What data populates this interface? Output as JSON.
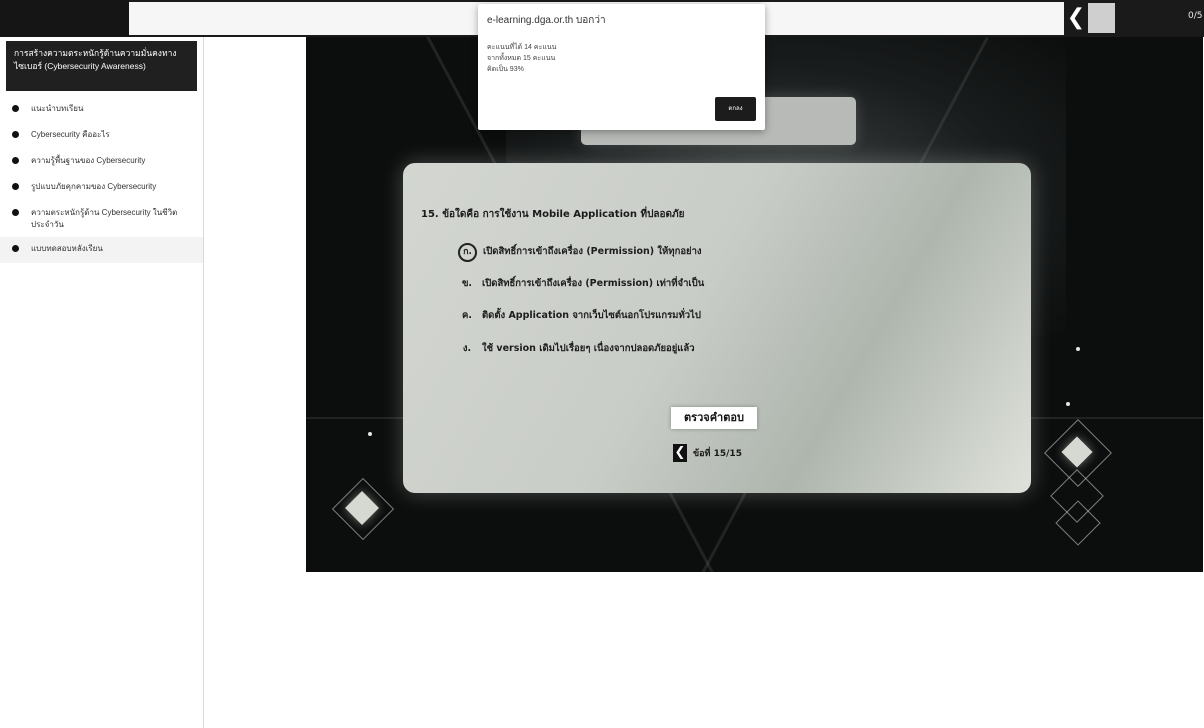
{
  "browser": {
    "back_glyph": "❮",
    "counter": "0/5"
  },
  "sidebar": {
    "title": "การสร้างความตระหนักรู้ด้านความมั่นคงทางไซเบอร์ (Cybersecurity Awareness)",
    "items": [
      {
        "label": "แนะนำบทเรียน"
      },
      {
        "label": "Cybersecurity คืออะไร"
      },
      {
        "label": "ความรู้พื้นฐานของ Cybersecurity"
      },
      {
        "label": "รูปแบบภัยคุกคามของ Cybersecurity"
      },
      {
        "label": "ความตระหนักรู้ด้าน Cybersecurity ในชีวิตประจำวัน"
      },
      {
        "label": "แบบทดสอบหลังเรียน"
      }
    ]
  },
  "quiz": {
    "question": "15. ข้อใดคือ การใช้งาน Mobile Application ที่ปลอดภัย",
    "choices": [
      {
        "mark": "ก.",
        "text": "เปิดสิทธิ์การเข้าถึงเครื่อง (Permission) ให้ทุกอย่าง"
      },
      {
        "mark": "ข.",
        "text": "เปิดสิทธิ์การเข้าถึงเครื่อง (Permission) เท่าที่จำเป็น"
      },
      {
        "mark": "ค.",
        "text": "ติดตั้ง Application จากเว็บไซต์นอกโปรแกรมทั่วไป"
      },
      {
        "mark": "ง.",
        "text": "ใช้ version เดิมไปเรื่อยๆ เนื่องจากปลอดภัยอยู่แล้ว"
      }
    ],
    "check_label": "ตรวจคำตอบ",
    "nav_back": "❮",
    "progress": "ข้อที่ 15/15"
  },
  "alert": {
    "title": "e-learning.dga.or.th บอกว่า",
    "lines": [
      "คะแนนที่ได้ 14 คะแนน",
      "จากทั้งหมด 15 คะแนน",
      "คิดเป็น 93%"
    ],
    "ok_label": "ตกลง"
  },
  "colors": {
    "topbar": "#1a1a1a",
    "stage": "#0c0e0e",
    "panel": "#cdd1cb",
    "sidebar_title_bg": "#202020"
  }
}
